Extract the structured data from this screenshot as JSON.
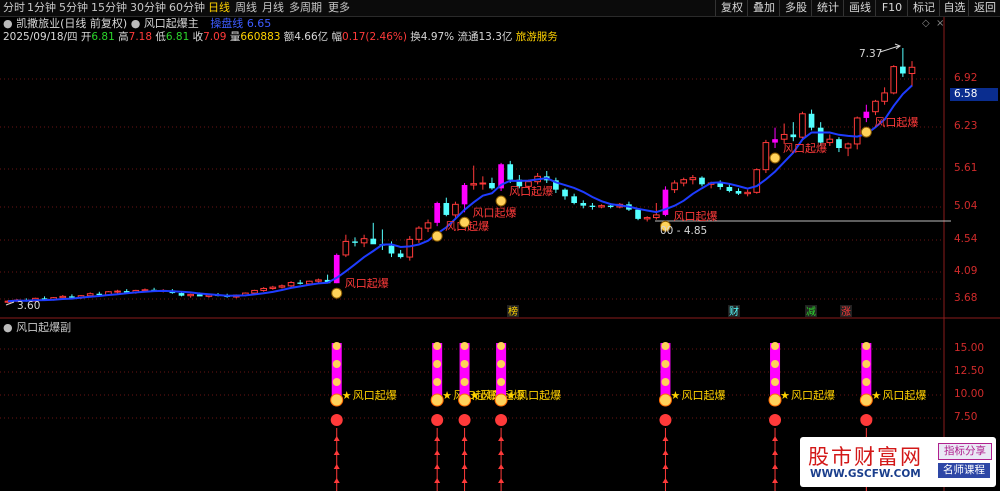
{
  "toolbar": {
    "tabs": [
      {
        "label": "分时",
        "x": 3
      },
      {
        "label": "1分钟",
        "x": 27
      },
      {
        "label": "5分钟",
        "x": 59
      },
      {
        "label": "15分钟",
        "x": 91
      },
      {
        "label": "30分钟",
        "x": 130
      },
      {
        "label": "60分钟",
        "x": 169
      },
      {
        "label": "日线",
        "x": 208,
        "active": true
      },
      {
        "label": "周线",
        "x": 235
      },
      {
        "label": "月线",
        "x": 262
      },
      {
        "label": "多周期",
        "x": 289
      },
      {
        "label": "更多",
        "x": 328
      }
    ],
    "right_buttons": [
      "复权",
      "叠加",
      "多股",
      "统计",
      "画线",
      "F10",
      "标记",
      "自选",
      "返回"
    ]
  },
  "header": {
    "stock": "凯撒旅业(日线 前复权)",
    "indicator": "风口起爆主",
    "ma_label": "操盘线",
    "ma_value": "6.65",
    "date": "2025/09/18/四",
    "open_label": "开",
    "open": "6.81",
    "high_label": "高",
    "high": "7.18",
    "low_label": "低",
    "low": "6.81",
    "close_label": "收",
    "close": "7.09",
    "vol_label": "量",
    "vol": "660883",
    "amt_label": "额",
    "amt": "4.66亿",
    "chg_label": "幅",
    "chg": "0.17(2.46%)",
    "turn_label": "换",
    "turn": "4.97%",
    "float_label": "流通",
    "float": "13.3亿",
    "sector": "旅游服务"
  },
  "main_chart": {
    "y_ticks": [
      "6.92",
      "6.23",
      "5.61",
      "5.04",
      "4.54",
      "4.09",
      "3.68"
    ],
    "current_price": "6.58",
    "high_marker": "7.37",
    "low_marker": "3.60",
    "range_label": "00 - 4.85",
    "signal_label": "风口起爆",
    "event_badges": [
      "榜",
      "财",
      "减",
      "涨"
    ]
  },
  "sub_chart": {
    "title": "风口起爆副",
    "y_ticks": [
      "15.00",
      "12.50",
      "10.00",
      "7.50"
    ],
    "signal_label": "风口起爆"
  },
  "watermark": {
    "title": "股市财富网",
    "url": "WWW.GSCFW.COM",
    "badge1": "指标分享",
    "badge2": "名师课程"
  },
  "colors": {
    "up": "#ff3a3a",
    "down": "#54ffff",
    "ma": "#1e3cff",
    "signal": "#ff00ff",
    "text_red": "#ff3a3a"
  }
}
